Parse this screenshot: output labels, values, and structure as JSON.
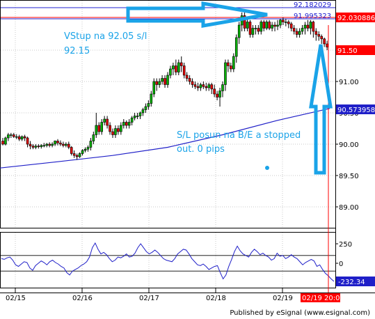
{
  "chart_data": [
    {
      "type": "candlestick",
      "x_ticks": [
        "02/15",
        "02/16",
        "02/17",
        "02/18",
        "02/19"
      ],
      "y_ticks": [
        "91.50",
        "91.00",
        "90.50",
        "90.00",
        "89.50",
        "89.00"
      ],
      "ylim": [
        88.7,
        92.25
      ],
      "series": [
        {
          "x": [
            0,
            1,
            2,
            3,
            4,
            5,
            6,
            7,
            8,
            9,
            10,
            11,
            12,
            13,
            14,
            15,
            16,
            17,
            18,
            19,
            20,
            21,
            22,
            23,
            24,
            25,
            26,
            27,
            28,
            29,
            30,
            31,
            32,
            33,
            34,
            35,
            36,
            37,
            38,
            39,
            40,
            41,
            42,
            43,
            44,
            45,
            46,
            47,
            48,
            49,
            50,
            51,
            52,
            53,
            54,
            55,
            56,
            57,
            58,
            59,
            60,
            61,
            62,
            63,
            64,
            65,
            66,
            67,
            68,
            69,
            70,
            71,
            72,
            73,
            74,
            75,
            76,
            77,
            78,
            79,
            80,
            81,
            82,
            83,
            84,
            85,
            86,
            87,
            88,
            89,
            90,
            91,
            92,
            93,
            94,
            95,
            96,
            97,
            98,
            99,
            100,
            101,
            102,
            103,
            104,
            105,
            106,
            107,
            108,
            109,
            110,
            111,
            112,
            113,
            114,
            115,
            116,
            117,
            118
          ],
          "open": [
            90.05,
            90.0,
            90.1,
            90.15,
            90.15,
            90.12,
            90.12,
            90.08,
            90.12,
            90.1,
            90.0,
            89.97,
            89.95,
            89.97,
            89.96,
            89.98,
            89.98,
            90.0,
            89.98,
            90.0,
            90.05,
            90.02,
            90.0,
            89.98,
            90.0,
            89.95,
            89.85,
            89.82,
            89.8,
            89.85,
            89.9,
            89.92,
            89.95,
            90.05,
            90.15,
            90.3,
            90.2,
            90.35,
            90.4,
            90.3,
            90.2,
            90.15,
            90.25,
            90.2,
            90.3,
            90.35,
            90.3,
            90.35,
            90.42,
            90.45,
            90.45,
            90.5,
            90.55,
            90.6,
            90.65,
            90.8,
            91.0,
            90.95,
            91.0,
            91.05,
            90.95,
            91.1,
            91.2,
            91.25,
            91.15,
            91.3,
            91.25,
            91.1,
            91.05,
            91.0,
            90.95,
            90.92,
            90.9,
            90.95,
            90.92,
            90.9,
            90.95,
            90.88,
            90.8,
            90.75,
            90.85,
            90.95,
            91.3,
            91.25,
            91.2,
            91.4,
            91.7,
            91.9,
            92.05,
            91.85,
            91.95,
            91.75,
            91.85,
            91.85,
            91.8,
            91.95,
            91.85,
            91.95,
            91.85,
            91.9,
            91.88,
            91.9,
            91.98,
            91.95,
            91.95,
            91.92,
            91.85,
            91.8,
            91.75,
            91.8,
            91.85,
            91.9,
            91.85,
            91.95,
            91.8,
            91.75,
            91.72,
            91.68,
            91.6
          ],
          "high": [
            90.1,
            90.12,
            90.18,
            90.18,
            90.18,
            90.16,
            90.15,
            90.14,
            90.15,
            90.12,
            90.05,
            90.0,
            90.0,
            90.0,
            90.0,
            90.02,
            90.02,
            90.03,
            90.03,
            90.06,
            90.08,
            90.06,
            90.04,
            90.03,
            90.04,
            89.97,
            89.9,
            89.85,
            89.87,
            89.92,
            89.95,
            89.98,
            90.1,
            90.2,
            90.5,
            90.35,
            90.4,
            90.45,
            90.45,
            90.35,
            90.25,
            90.3,
            90.3,
            90.35,
            90.4,
            90.38,
            90.4,
            90.45,
            90.5,
            90.5,
            90.52,
            90.58,
            90.65,
            90.7,
            90.85,
            91.05,
            91.05,
            91.05,
            91.1,
            91.1,
            91.15,
            91.25,
            91.3,
            91.35,
            91.35,
            91.4,
            91.3,
            91.15,
            91.1,
            91.05,
            91.0,
            90.98,
            90.98,
            91.0,
            90.98,
            90.98,
            90.98,
            90.95,
            90.85,
            90.9,
            91.0,
            91.35,
            91.35,
            91.3,
            91.45,
            91.75,
            91.95,
            92.1,
            92.1,
            92.0,
            91.98,
            91.9,
            91.9,
            91.9,
            91.98,
            91.98,
            91.98,
            91.98,
            91.95,
            91.95,
            91.98,
            92.0,
            92.02,
            92.0,
            91.98,
            91.95,
            91.9,
            91.85,
            91.85,
            91.9,
            91.95,
            91.98,
            91.98,
            91.97,
            91.85,
            91.8,
            91.75,
            91.7,
            91.65
          ],
          "low": [
            89.98,
            89.98,
            90.05,
            90.1,
            90.1,
            90.08,
            90.05,
            90.05,
            90.05,
            89.95,
            89.92,
            89.92,
            89.92,
            89.93,
            89.93,
            89.95,
            89.95,
            89.95,
            89.95,
            89.97,
            89.98,
            89.97,
            89.95,
            89.95,
            89.92,
            89.82,
            89.78,
            89.75,
            89.78,
            89.82,
            89.87,
            89.88,
            89.9,
            90.0,
            90.1,
            90.15,
            90.15,
            90.3,
            90.25,
            90.15,
            90.1,
            90.1,
            90.15,
            90.15,
            90.25,
            90.25,
            90.25,
            90.3,
            90.38,
            90.4,
            90.4,
            90.45,
            90.5,
            90.55,
            90.6,
            90.75,
            90.85,
            90.9,
            90.95,
            90.9,
            90.9,
            91.05,
            91.1,
            91.1,
            91.1,
            91.15,
            91.05,
            91.0,
            90.95,
            90.9,
            90.88,
            90.85,
            90.85,
            90.88,
            90.85,
            90.85,
            90.8,
            90.75,
            90.7,
            90.6,
            90.75,
            90.85,
            91.15,
            91.15,
            91.15,
            91.3,
            91.6,
            91.8,
            91.8,
            91.8,
            91.7,
            91.7,
            91.75,
            91.75,
            91.75,
            91.8,
            91.82,
            91.82,
            91.8,
            91.8,
            91.82,
            91.85,
            91.9,
            91.88,
            91.85,
            91.8,
            91.75,
            91.7,
            91.7,
            91.75,
            91.75,
            91.8,
            91.75,
            91.7,
            91.65,
            91.65,
            91.6,
            91.55,
            91.5
          ],
          "close": [
            90.0,
            90.1,
            90.15,
            90.15,
            90.12,
            90.12,
            90.08,
            90.12,
            90.1,
            90.0,
            89.97,
            89.95,
            89.97,
            89.96,
            89.98,
            89.98,
            90.0,
            89.98,
            90.0,
            90.05,
            90.02,
            90.0,
            89.98,
            90.0,
            89.95,
            89.85,
            89.82,
            89.8,
            89.85,
            89.9,
            89.92,
            89.95,
            90.05,
            90.15,
            90.3,
            90.2,
            90.35,
            90.4,
            90.3,
            90.2,
            90.15,
            90.25,
            90.2,
            90.3,
            90.35,
            90.3,
            90.35,
            90.42,
            90.45,
            90.45,
            90.5,
            90.55,
            90.6,
            90.65,
            90.8,
            91.0,
            90.95,
            91.0,
            91.05,
            90.95,
            91.1,
            91.2,
            91.25,
            91.15,
            91.3,
            91.25,
            91.1,
            91.05,
            91.0,
            90.95,
            90.92,
            90.9,
            90.95,
            90.92,
            90.9,
            90.95,
            90.88,
            90.8,
            90.75,
            90.85,
            90.95,
            91.3,
            91.25,
            91.2,
            91.4,
            91.7,
            91.9,
            92.05,
            91.85,
            91.95,
            91.75,
            91.85,
            91.85,
            91.8,
            91.95,
            91.85,
            91.95,
            91.85,
            91.9,
            91.88,
            91.9,
            91.98,
            91.95,
            91.95,
            91.92,
            91.85,
            91.8,
            91.75,
            91.8,
            91.85,
            91.9,
            91.85,
            91.95,
            91.8,
            91.75,
            91.72,
            91.68,
            91.6,
            91.55
          ]
        },
        {
          "type": "line",
          "color": "#1f1fc8",
          "x": [
            -1,
            20,
            40,
            60,
            80,
            100,
            119
          ],
          "y": [
            89.62,
            89.72,
            89.82,
            89.95,
            90.15,
            90.38,
            90.57
          ]
        }
      ],
      "horizontal_levels": [
        {
          "value": "92.182029",
          "color": "#2020d0"
        },
        {
          "value": "91.995323",
          "color": "#2020d0"
        },
        {
          "value": "92.030886",
          "color": "#ff0000"
        }
      ],
      "price_tags": [
        {
          "value": 92.030886,
          "label": "92.030886",
          "bg": "#ff0000",
          "fg": "#ffffff"
        },
        {
          "value": 91.5,
          "label": "91.50",
          "bg": "#ff0000",
          "fg": "#ffffff"
        },
        {
          "value": 90.573958,
          "label": "90.573958",
          "bg": "#1f1fc8",
          "fg": "#ffffff"
        }
      ],
      "vline_label": "02/19 20:00",
      "annotations": [
        {
          "lines": [
            "VStup na 92.05 s/l",
            "92.15"
          ],
          "color": "#1aa3e8"
        },
        {
          "lines": [
            "S/L posun na B/E a stopped",
            "out. 0 pips"
          ],
          "color": "#1aa3e8"
        }
      ]
    },
    {
      "type": "line",
      "y_ticks": [
        "250",
        "0"
      ],
      "ylim": [
        -320,
        300
      ],
      "last_value_label": "-232.34",
      "reference_lines": [
        100,
        -100
      ],
      "series": [
        {
          "color": "#1f1fc8",
          "y": [
            60,
            50,
            70,
            80,
            40,
            -20,
            -40,
            -10,
            20,
            10,
            -60,
            -90,
            -30,
            0,
            30,
            10,
            -20,
            20,
            40,
            10,
            -10,
            -40,
            -60,
            -120,
            -150,
            -100,
            -80,
            -60,
            -30,
            -10,
            20,
            80,
            200,
            260,
            180,
            120,
            140,
            110,
            60,
            20,
            40,
            80,
            70,
            90,
            120,
            80,
            90,
            130,
            200,
            250,
            200,
            150,
            120,
            140,
            170,
            140,
            100,
            60,
            40,
            30,
            20,
            60,
            120,
            150,
            180,
            170,
            120,
            60,
            20,
            -20,
            -30,
            -10,
            -40,
            -80,
            -60,
            -40,
            -30,
            -120,
            -200,
            -150,
            -40,
            50,
            150,
            220,
            160,
            120,
            100,
            80,
            140,
            180,
            150,
            110,
            130,
            100,
            80,
            40,
            60,
            130,
            90,
            100,
            60,
            80,
            110,
            80,
            60,
            20,
            -20,
            10,
            30,
            50,
            30,
            -40,
            -20,
            -80,
            -130,
            -160,
            -200,
            -232
          ]
        }
      ]
    }
  ],
  "footer": {
    "text": "Published by eSignal (www.esignal.com)"
  }
}
